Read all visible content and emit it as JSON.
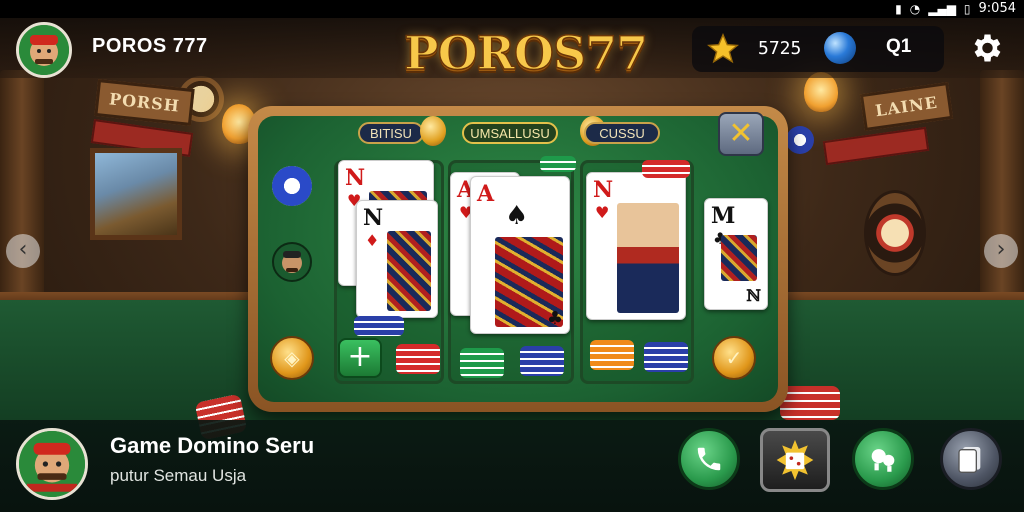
{
  "status_bar": {
    "time": "9:054"
  },
  "header": {
    "title": "POROS 777",
    "logo_text": "POROS77",
    "coins": "5725",
    "level": "Q1"
  },
  "room": {
    "sign_left": "PORSH",
    "sign_right": "LAINE"
  },
  "table": {
    "tabs": [
      {
        "label": "BITISU"
      },
      {
        "label": "UMSALLUSU"
      },
      {
        "label": "CUSSU"
      }
    ],
    "close_label": "✕",
    "cards": [
      {
        "rank": "N",
        "suit": "♥",
        "color": "red"
      },
      {
        "rank": "N",
        "suit": "♦",
        "color": "black"
      },
      {
        "rank": "A",
        "suit": "♥",
        "color": "red"
      },
      {
        "rank": "A",
        "suit": "♠",
        "color": "red"
      },
      {
        "rank": "N",
        "suit": "♥",
        "color": "red"
      },
      {
        "rank": "M",
        "suit": "♣",
        "color": "black"
      }
    ],
    "card_corner_1": "♣",
    "card_corner_2": "ℕ"
  },
  "footer": {
    "game_title": "Game Domino Seru",
    "game_subtitle": "putur Semau Usja"
  },
  "colors": {
    "felt": "#2f8a46",
    "panel_wood": "#c48a48",
    "logo_gold": "#f7c84a",
    "accent_green": "#2a9a4c"
  },
  "icons": [
    "star-icon",
    "globe-icon",
    "gear-icon",
    "chevron-left-icon",
    "chevron-right-icon",
    "close-icon",
    "plus-icon",
    "phone-icon",
    "gift-icon",
    "chat-icon",
    "cards-icon"
  ]
}
